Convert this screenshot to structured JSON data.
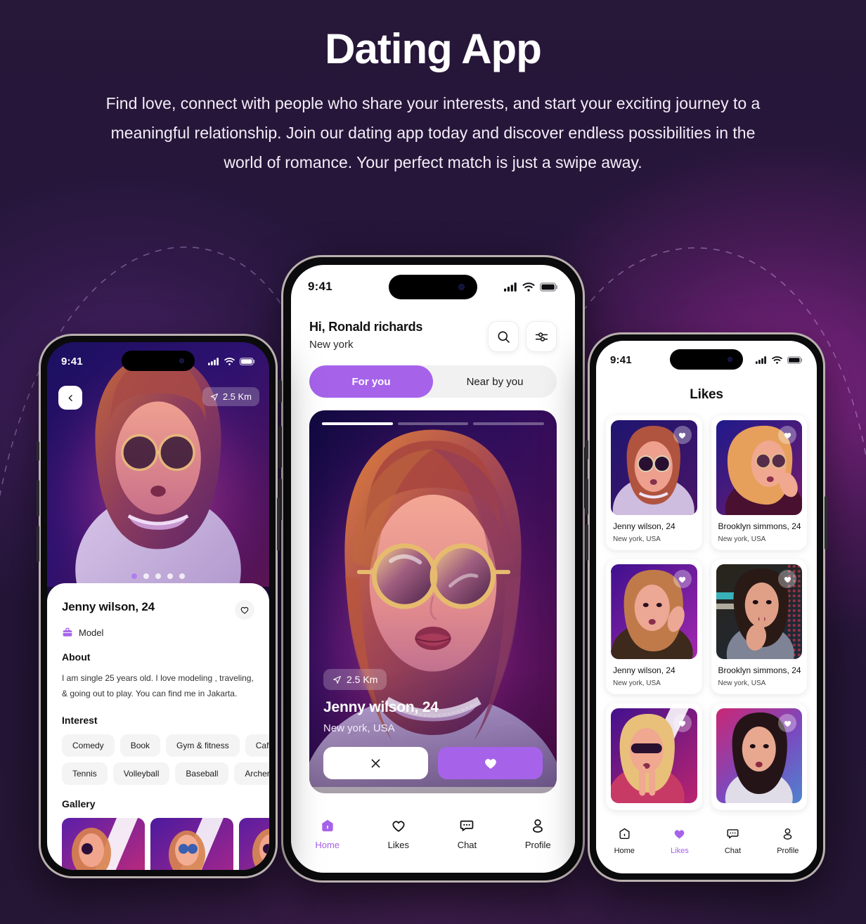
{
  "hero": {
    "title": "Dating App",
    "subtitle": "Find love, connect with people who share your interests, and start your exciting journey to a meaningful relationship. Join our dating app today and discover endless possibilities in the world of romance. Your perfect match is just a swipe away."
  },
  "colors": {
    "accent": "#a663ea",
    "background": "#241634",
    "glow": "#962896",
    "card_surface": "#ffffff",
    "chip": "#f4f4f4"
  },
  "status_bar": {
    "time": "9:41",
    "cellular_icon": "cellular-signal-icon",
    "wifi_icon": "wifi-icon",
    "battery_icon": "battery-icon"
  },
  "center_phone": {
    "screen_name": "home-discover",
    "greeting": "Hi, Ronald richards",
    "location": "New york",
    "search_icon": "search-icon",
    "filter_icon": "filter-sliders-icon",
    "tabs": [
      {
        "label": "For you",
        "active": true
      },
      {
        "label": "Near by you",
        "active": false
      }
    ],
    "card": {
      "distance": "2.5 Km",
      "distance_icon": "location-arrow-icon",
      "name": "Jenny wilson, 24",
      "location": "New york, USA",
      "photo_count": 3,
      "photo_index": 1,
      "pass_icon": "close-x-icon",
      "like_icon": "heart-filled-icon"
    },
    "nav": [
      {
        "label": "Home",
        "icon": "home-icon",
        "active": true
      },
      {
        "label": "Likes",
        "icon": "heart-outline-icon",
        "active": false
      },
      {
        "label": "Chat",
        "icon": "chat-bubble-icon",
        "active": false
      },
      {
        "label": "Profile",
        "icon": "person-icon",
        "active": false
      }
    ]
  },
  "left_phone": {
    "screen_name": "profile-detail",
    "back_icon": "chevron-left-icon",
    "distance": "2.5 Km",
    "distance_icon": "location-arrow-icon",
    "carousel_dots": 5,
    "carousel_index": 1,
    "name": "Jenny wilson, 24",
    "favorite_icon": "heart-outline-icon",
    "job_icon": "briefcase-icon",
    "job": "Model",
    "about_heading": "About",
    "about_text": "I am single 25 years old. I love modeling , traveling, & going out to play. You can find me in Jakarta.",
    "interest_heading": "Interest",
    "interests": [
      "Comedy",
      "Book",
      "Gym & fitness",
      "Cafe",
      "Tennis",
      "Volleyball",
      "Baseball",
      "Archery"
    ],
    "gallery_heading": "Gallery",
    "gallery_count": 3
  },
  "right_phone": {
    "screen_name": "likes",
    "title": "Likes",
    "heart_icon": "heart-filled-icon",
    "cards": [
      {
        "name": "Jenny wilson, 24",
        "location": "New york, USA"
      },
      {
        "name": "Brooklyn simmons, 24",
        "location": "New york, USA"
      },
      {
        "name": "Jenny wilson, 24",
        "location": "New york, USA"
      },
      {
        "name": "Brooklyn simmons, 24",
        "location": "New york, USA"
      },
      {
        "name": "",
        "location": ""
      },
      {
        "name": "",
        "location": ""
      }
    ],
    "nav": [
      {
        "label": "Home",
        "icon": "home-icon",
        "active": false
      },
      {
        "label": "Likes",
        "icon": "heart-filled-icon",
        "active": true
      },
      {
        "label": "Chat",
        "icon": "chat-bubble-icon",
        "active": false
      },
      {
        "label": "Profile",
        "icon": "person-icon",
        "active": false
      }
    ]
  }
}
